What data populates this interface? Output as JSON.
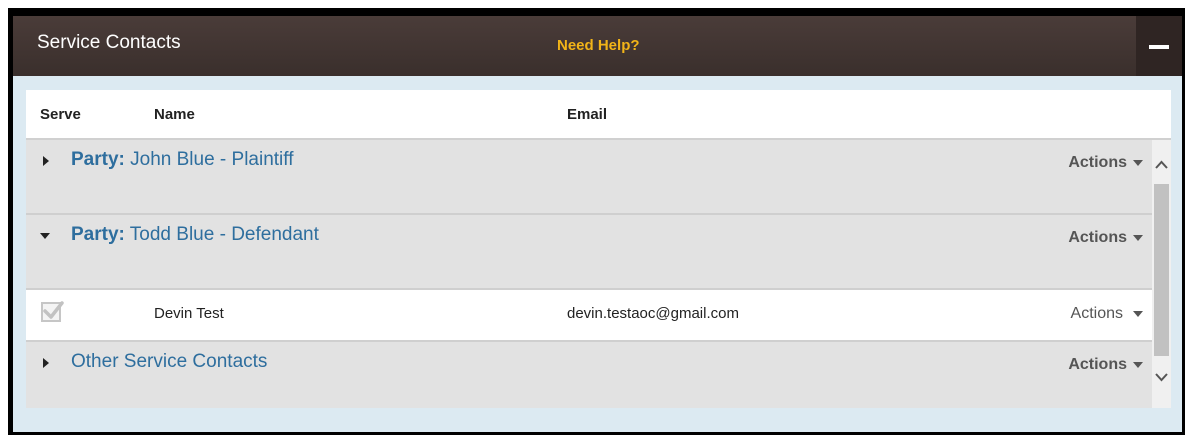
{
  "panel": {
    "title": "Service Contacts",
    "help_link": "Need Help?",
    "collapse_icon": "minus-icon"
  },
  "columns": {
    "serve": "Serve",
    "name": "Name",
    "email": "Email"
  },
  "parties": [
    {
      "prefix": "Party:",
      "label": "John Blue - Plaintiff",
      "expanded": false,
      "actions": "Actions"
    },
    {
      "prefix": "Party:",
      "label": "Todd Blue - Defendant",
      "expanded": true,
      "actions": "Actions",
      "contacts": [
        {
          "serve_checked": true,
          "name": "Devin Test",
          "email": "devin.testaoc@gmail.com",
          "actions": "Actions"
        }
      ]
    }
  ],
  "other": {
    "label": "Other Service Contacts",
    "expanded": false,
    "actions": "Actions"
  },
  "colors": {
    "header_bg": "#3f3330",
    "help_link": "#f2b418",
    "party_text": "#2e6e9e",
    "row_bg": "#e2e2e2",
    "panel_bg": "#dceaf2"
  }
}
